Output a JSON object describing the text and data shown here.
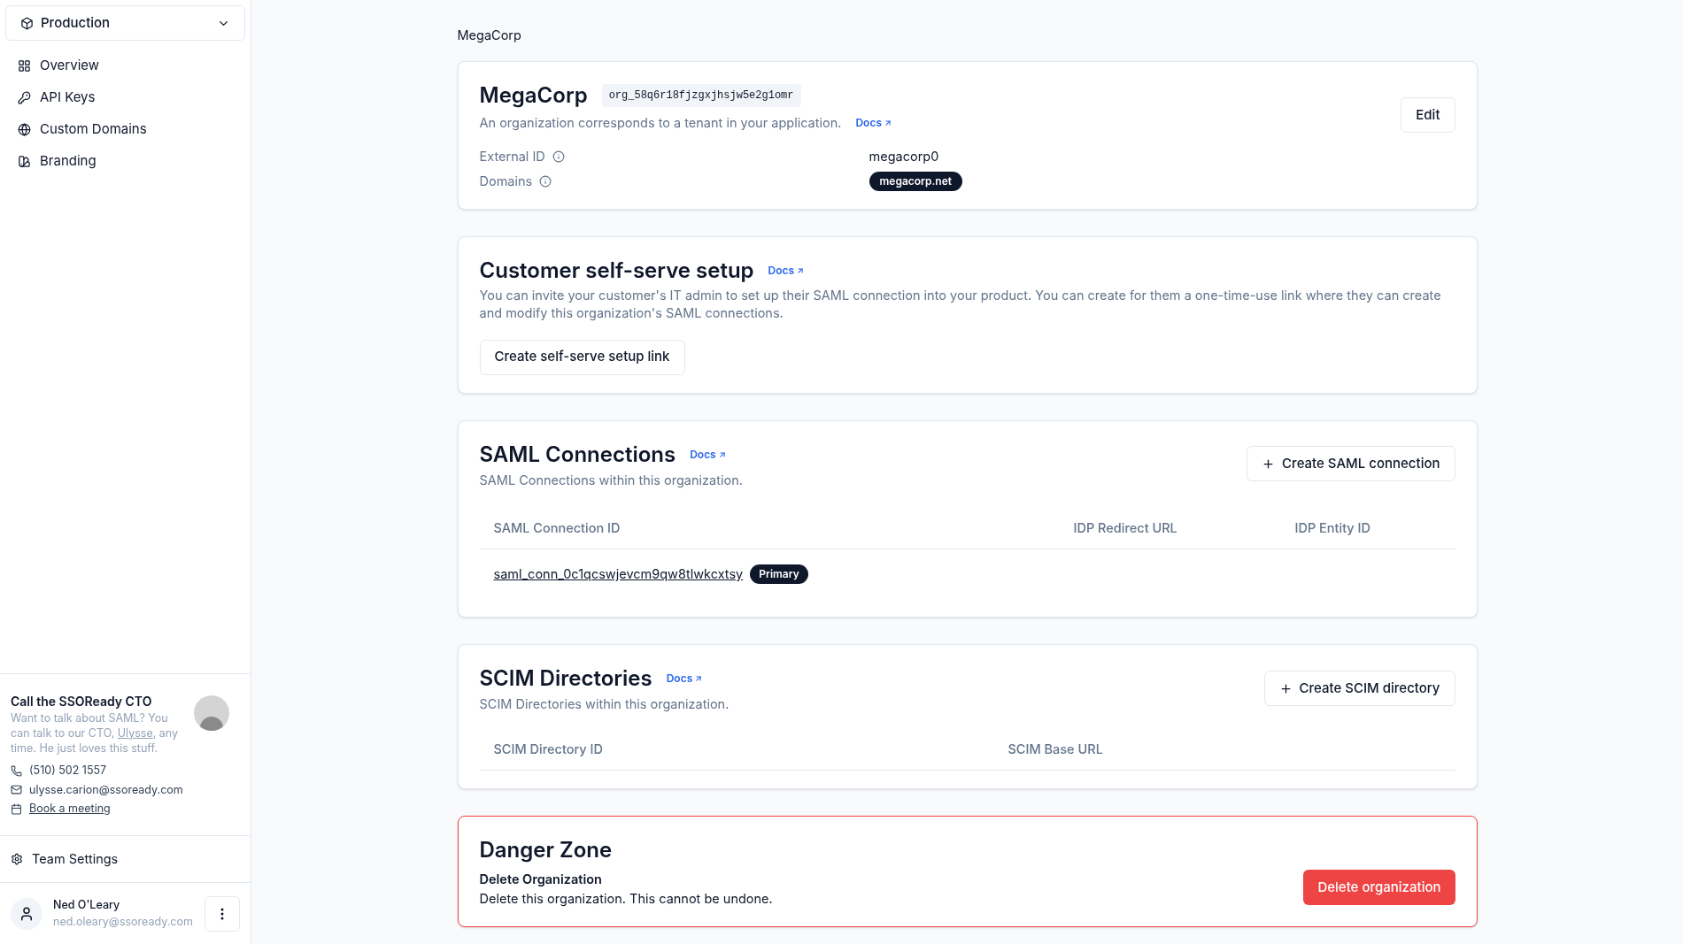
{
  "sidebar": {
    "environment": "Production",
    "items": [
      {
        "label": "Overview"
      },
      {
        "label": "API Keys"
      },
      {
        "label": "Custom Domains"
      },
      {
        "label": "Branding"
      }
    ],
    "cto_card": {
      "title": "Call the SSOReady CTO",
      "text_before": "Want to talk about SAML? You can talk to our CTO,",
      "link": "Ulysse",
      "text_after": ", any time. He just loves this stuff.",
      "phone": "(510) 502 1557",
      "email": "ulysse.carion@ssoready.com",
      "meeting": "Book a meeting"
    },
    "team_settings": "Team Settings",
    "user": {
      "name": "Ned O'Leary",
      "email": "ned.oleary@ssoready.com"
    }
  },
  "breadcrumb": "MegaCorp",
  "organization": {
    "name": "MegaCorp",
    "id": "org_58q6r18fjzgxjhsjw5e2g1omr",
    "description": "An organization corresponds to a tenant in your application.",
    "docs": "Docs",
    "edit": "Edit",
    "fields": [
      {
        "label": "External ID",
        "kind": "text",
        "value": "megacorp0"
      },
      {
        "label": "Domains",
        "kind": "tags",
        "values": [
          "megacorp.net"
        ]
      }
    ]
  },
  "self_serve": {
    "title": "Customer self-serve setup",
    "docs": "Docs",
    "description": "You can invite your customer's IT admin to set up their SAML connection into your product. You can create for them a one-time-use link where they can create and modify this organization's SAML connections.",
    "button": "Create self-serve setup link"
  },
  "saml": {
    "title": "SAML Connections",
    "docs": "Docs",
    "description": "SAML Connections within this organization.",
    "button": "Create SAML connection",
    "columns": [
      "SAML Connection ID",
      "IDP Redirect URL",
      "IDP Entity ID"
    ],
    "rows": [
      {
        "id": "saml_conn_0c1qcswjevcm9qw8tlwkcxtsy",
        "badge": "Primary"
      }
    ]
  },
  "scim": {
    "title": "SCIM Directories",
    "docs": "Docs",
    "description": "SCIM Directories within this organization.",
    "button": "Create SCIM directory",
    "columns": [
      "SCIM Directory ID",
      "SCIM Base URL"
    ]
  },
  "danger": {
    "title": "Danger Zone",
    "item_title": "Delete Organization",
    "item_description": "Delete this organization. This cannot be undone.",
    "button": "Delete organization"
  }
}
